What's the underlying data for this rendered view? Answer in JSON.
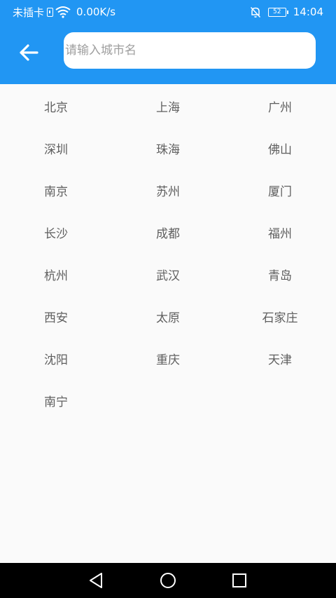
{
  "status_bar": {
    "carrier_text": "未插卡",
    "network_speed": "0.00K/s",
    "battery_level": "52",
    "time": "14:04",
    "icons": [
      "sim-icon",
      "wifi-icon",
      "mute-bell-icon",
      "battery-icon"
    ]
  },
  "header": {
    "back_icon": "arrow-left-icon",
    "search": {
      "placeholder": "请输入城市名",
      "value": ""
    },
    "color": "#2196f3"
  },
  "cities": [
    "北京",
    "上海",
    "广州",
    "深圳",
    "珠海",
    "佛山",
    "南京",
    "苏州",
    "厦门",
    "长沙",
    "成都",
    "福州",
    "杭州",
    "武汉",
    "青岛",
    "西安",
    "太原",
    "石家庄",
    "沈阳",
    "重庆",
    "天津",
    "南宁"
  ],
  "nav_bar": {
    "icons": [
      "back-triangle-icon",
      "home-circle-icon",
      "recents-square-icon"
    ]
  }
}
